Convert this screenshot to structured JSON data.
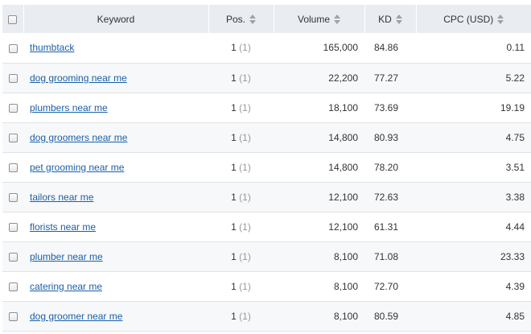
{
  "table": {
    "headers": {
      "keyword": "Keyword",
      "pos": "Pos.",
      "volume": "Volume",
      "kd": "KD",
      "cpc": "CPC (USD)"
    },
    "rows": [
      {
        "keyword": "thumbtack",
        "pos": "1",
        "pos_prev": "(1)",
        "volume": "165,000",
        "kd": "84.86",
        "cpc": "0.11"
      },
      {
        "keyword": "dog grooming near me",
        "pos": "1",
        "pos_prev": "(1)",
        "volume": "22,200",
        "kd": "77.27",
        "cpc": "5.22"
      },
      {
        "keyword": "plumbers near me",
        "pos": "1",
        "pos_prev": "(1)",
        "volume": "18,100",
        "kd": "73.69",
        "cpc": "19.19"
      },
      {
        "keyword": "dog groomers near me",
        "pos": "1",
        "pos_prev": "(1)",
        "volume": "14,800",
        "kd": "80.93",
        "cpc": "4.75"
      },
      {
        "keyword": "pet grooming near me",
        "pos": "1",
        "pos_prev": "(1)",
        "volume": "14,800",
        "kd": "78.20",
        "cpc": "3.51"
      },
      {
        "keyword": "tailors near me",
        "pos": "1",
        "pos_prev": "(1)",
        "volume": "12,100",
        "kd": "72.63",
        "cpc": "3.38"
      },
      {
        "keyword": "florists near me",
        "pos": "1",
        "pos_prev": "(1)",
        "volume": "12,100",
        "kd": "61.31",
        "cpc": "4.44"
      },
      {
        "keyword": "plumber near me",
        "pos": "1",
        "pos_prev": "(1)",
        "volume": "8,100",
        "kd": "71.08",
        "cpc": "23.33"
      },
      {
        "keyword": "catering near me",
        "pos": "1",
        "pos_prev": "(1)",
        "volume": "8,100",
        "kd": "72.70",
        "cpc": "4.39"
      },
      {
        "keyword": "dog groomer near me",
        "pos": "1",
        "pos_prev": "(1)",
        "volume": "8,100",
        "kd": "80.59",
        "cpc": "4.85"
      }
    ]
  },
  "colors": {
    "header_bg": "#e9edf1",
    "link": "#1a5fa8",
    "row_alt": "#f7f8f9"
  }
}
